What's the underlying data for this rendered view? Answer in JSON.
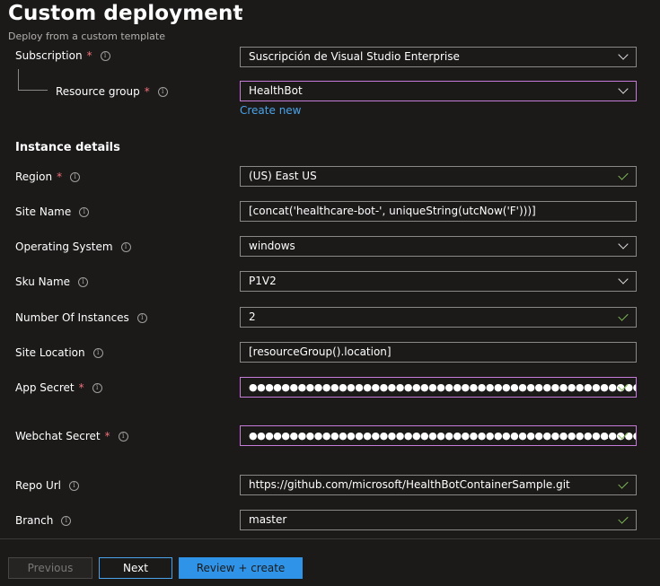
{
  "header": {
    "title": "Custom deployment",
    "more": "···",
    "subtitle": "Deploy from a custom template"
  },
  "project": {
    "subscription_label": "Subscription",
    "subscription_value": "Suscripción de Visual Studio Enterprise",
    "resource_group_label": "Resource group",
    "resource_group_value": "HealthBot",
    "create_new": "Create new"
  },
  "instance": {
    "heading": "Instance details",
    "fields": [
      {
        "label": "Region",
        "value": "(US) East US"
      },
      {
        "label": "Site Name",
        "value": "[concat('healthcare-bot-', uniqueString(utcNow('F')))]"
      },
      {
        "label": "Operating System",
        "value": "windows"
      },
      {
        "label": "Sku Name",
        "value": "P1V2"
      },
      {
        "label": "Number Of Instances",
        "value": "2"
      },
      {
        "label": "Site Location",
        "value": "[resourceGroup().location]"
      },
      {
        "label": "App Secret",
        "value": "●●●●●●●●●●●●●●●●●●●●●●●●●●●●●●●●●●●●●●●●●●●●●●●●●"
      },
      {
        "label": "Webchat Secret",
        "value": "●●●●●●●●●●●●●●●●●●●●●●●●●●●●●●●●●●●●●●●●●●●●●●●●●●●●●●●●●●●●●●●●●",
        "ellipsis": "..."
      },
      {
        "label": "Repo Url",
        "value": "https://github.com/microsoft/HealthBotContainerSample.git"
      },
      {
        "label": "Branch",
        "value": "master"
      }
    ]
  },
  "footer": {
    "previous": "Previous",
    "next": "Next",
    "review": "Review + create"
  },
  "colors": {
    "accent": "#2f94e8",
    "focus": "#c77bd8",
    "required": "#f1707b",
    "valid": "#7fba56"
  }
}
